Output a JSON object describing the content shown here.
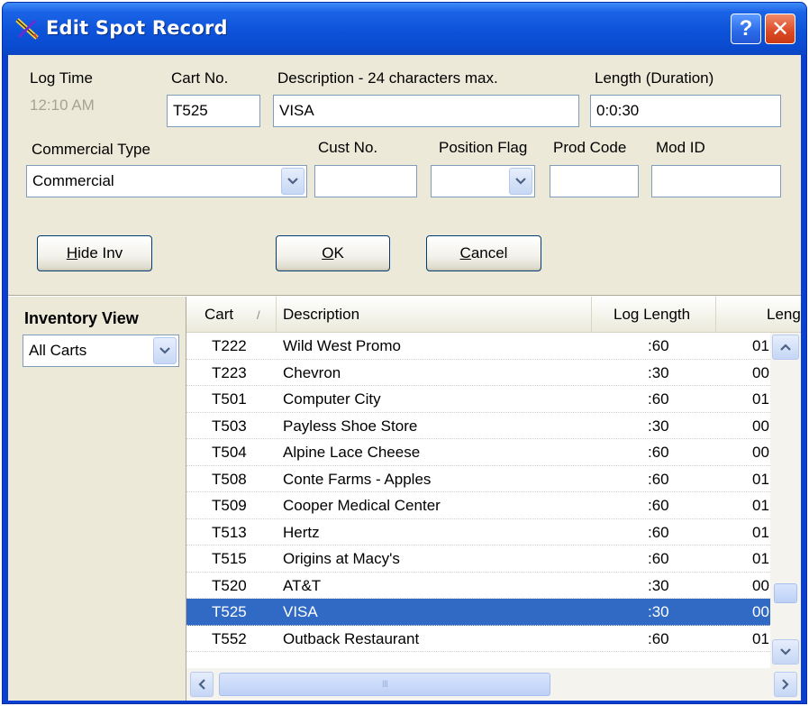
{
  "window": {
    "title": "Edit Spot Record",
    "help_glyph": "?",
    "close_glyph": "✕"
  },
  "form": {
    "log_time_label": "Log Time",
    "log_time_value": "12:10 AM",
    "cart_no_label": "Cart No.",
    "cart_no_value": "T525",
    "description_label": "Description - 24 characters max.",
    "description_value": "VISA",
    "length_label": "Length (Duration)",
    "length_value": "0:0:30",
    "commercial_type_label": "Commercial Type",
    "commercial_type_value": "Commercial",
    "cust_no_label": "Cust No.",
    "cust_no_value": "",
    "position_flag_label": "Position Flag",
    "position_flag_value": "",
    "prod_code_label": "Prod Code",
    "prod_code_value": "",
    "mod_id_label": "Mod ID",
    "mod_id_value": ""
  },
  "buttons": {
    "hide_inv_u": "H",
    "hide_inv_rest": "ide Inv",
    "ok_u": "O",
    "ok_rest": "K",
    "cancel_u": "C",
    "cancel_rest": "ancel"
  },
  "inventory": {
    "title": "Inventory View",
    "filter_value": "All Carts"
  },
  "grid": {
    "columns": [
      "Cart",
      "Description",
      "Log Length",
      "Leng"
    ],
    "sort_glyph": "/",
    "rows": [
      {
        "cart": "T222",
        "description": "Wild West Promo",
        "log_length": ":60",
        "length": "01"
      },
      {
        "cart": "T223",
        "description": "Chevron",
        "log_length": ":30",
        "length": "00"
      },
      {
        "cart": "T501",
        "description": "Computer City",
        "log_length": ":60",
        "length": "01"
      },
      {
        "cart": "T503",
        "description": "Payless Shoe Store",
        "log_length": ":30",
        "length": "00"
      },
      {
        "cart": "T504",
        "description": "Alpine Lace Cheese",
        "log_length": ":60",
        "length": "00"
      },
      {
        "cart": "T508",
        "description": "Conte Farms - Apples",
        "log_length": ":60",
        "length": "01"
      },
      {
        "cart": "T509",
        "description": "Cooper Medical Center",
        "log_length": ":60",
        "length": "01"
      },
      {
        "cart": "T513",
        "description": "Hertz",
        "log_length": ":60",
        "length": "01"
      },
      {
        "cart": "T515",
        "description": "Origins at Macy's",
        "log_length": ":60",
        "length": "01"
      },
      {
        "cart": "T520",
        "description": "AT&T",
        "log_length": ":30",
        "length": "00"
      },
      {
        "cart": "T525",
        "description": "VISA",
        "log_length": ":30",
        "length": "00"
      },
      {
        "cart": "T552",
        "description": "Outback Restaurant",
        "log_length": ":60",
        "length": "01"
      }
    ],
    "selected_row": 10,
    "hscroll_grip": "III"
  }
}
